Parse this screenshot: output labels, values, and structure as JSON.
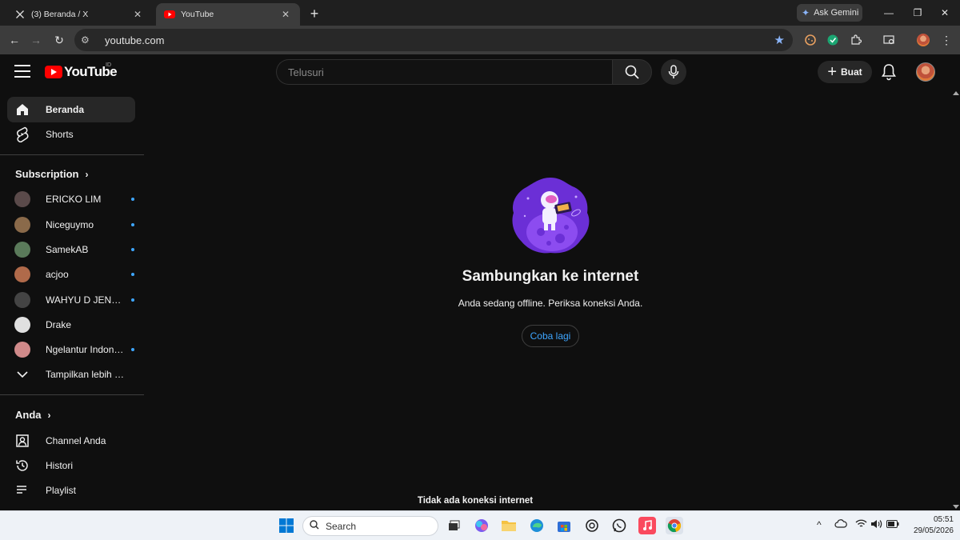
{
  "browser": {
    "tabs": [
      {
        "title": "(3) Beranda / X",
        "active": false
      },
      {
        "title": "YouTube",
        "active": true
      }
    ],
    "ask_gemini": "Ask Gemini",
    "url": "youtube.com"
  },
  "yt": {
    "logo_word": "YouTube",
    "country": "ID",
    "search_placeholder": "Telusuri",
    "create_label": "Buat"
  },
  "sidebar": {
    "main": [
      {
        "label": "Beranda",
        "icon": "home-icon",
        "active": true
      },
      {
        "label": "Shorts",
        "icon": "shorts-icon",
        "active": false
      }
    ],
    "subscriptions_title": "Subscription",
    "subscriptions": [
      {
        "name": "ERICKO LIM",
        "new": true,
        "color": "#5a4a4a"
      },
      {
        "name": "Niceguymo",
        "new": true,
        "color": "#8a6a4a"
      },
      {
        "name": "SamekAB",
        "new": true,
        "color": "#5a7a5a"
      },
      {
        "name": "acjoo",
        "new": true,
        "color": "#b06a4a"
      },
      {
        "name": "WAHYU D JENGGOT",
        "new": true,
        "color": "#444444"
      },
      {
        "name": "Drake",
        "new": false,
        "color": "#e0e0e0"
      },
      {
        "name": "Ngelantur Indonesia",
        "new": true,
        "color": "#d08a8a"
      }
    ],
    "show_more": "Tampilkan lebih banyak",
    "you_title": "Anda",
    "you_items": [
      {
        "label": "Channel Anda",
        "icon": "channel-icon"
      },
      {
        "label": "Histori",
        "icon": "history-icon"
      },
      {
        "label": "Playlist",
        "icon": "playlist-icon"
      }
    ]
  },
  "offline": {
    "title": "Sambungkan ke internet",
    "message": "Anda sedang offline. Periksa koneksi Anda.",
    "retry": "Coba lagi",
    "toast": "Tidak ada koneksi internet"
  },
  "taskbar": {
    "search_placeholder": "Search",
    "time": "05:51",
    "date": "29/05/2026"
  }
}
